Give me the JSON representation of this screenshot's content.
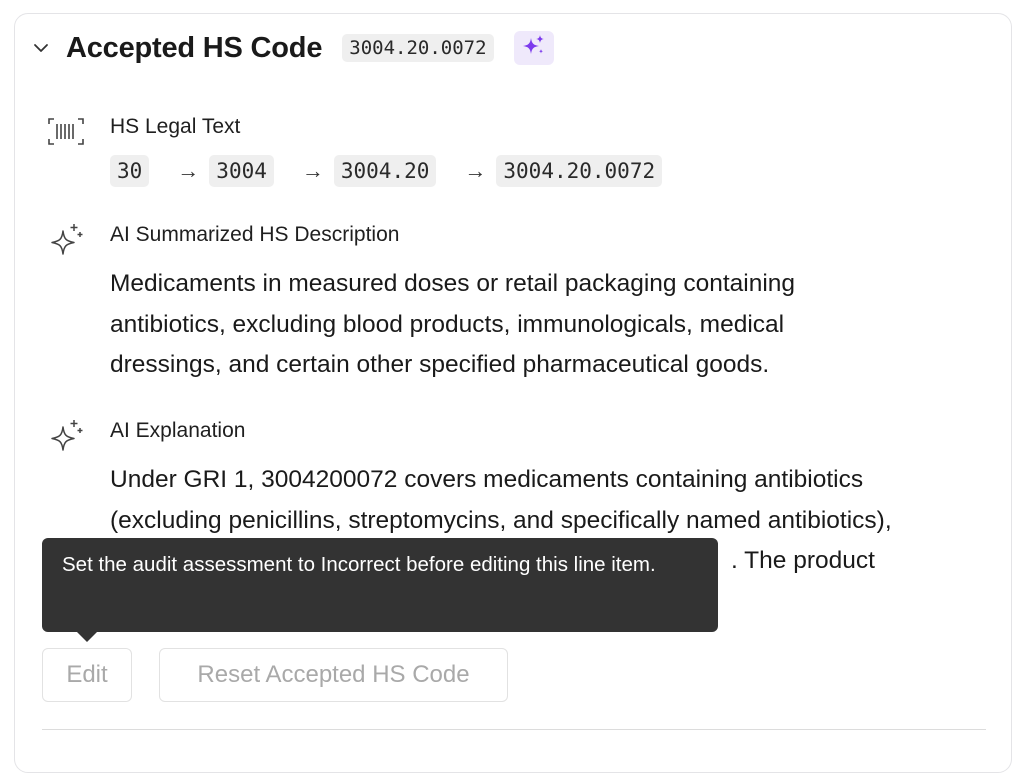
{
  "header": {
    "title": "Accepted HS Code",
    "code": "3004.20.0072",
    "chevron_icon": "chevron-down-icon",
    "badge_icon": "sparkle-icon",
    "accent_color": "#7c3aed"
  },
  "legal_text": {
    "label": "HS Legal Text",
    "icon": "barcode-icon",
    "path": [
      "30",
      "3004",
      "3004.20",
      "3004.20.0072"
    ],
    "arrow": "→"
  },
  "summary": {
    "label": "AI Summarized HS Description",
    "icon": "sparkle-outline-icon",
    "line1": "Medicaments in measured doses or retail packaging containing",
    "line2": "antibiotics, excluding blood products, immunologicals, medical",
    "line3": "dressings, and certain other specified pharmaceutical goods."
  },
  "explanation": {
    "label": "AI Explanation",
    "icon": "sparkle-outline-icon",
    "line1": "Under GRI 1, 3004200072 covers medicaments containing antibiotics",
    "line2": "(excluding penicillins, streptomycins, and specifically named antibiotics),",
    "line3_visible": ". The product"
  },
  "tooltip": {
    "text": "Set the audit assessment to Incorrect before editing this line item."
  },
  "actions": {
    "edit_label": "Edit",
    "reset_label": "Reset Accepted HS Code"
  }
}
